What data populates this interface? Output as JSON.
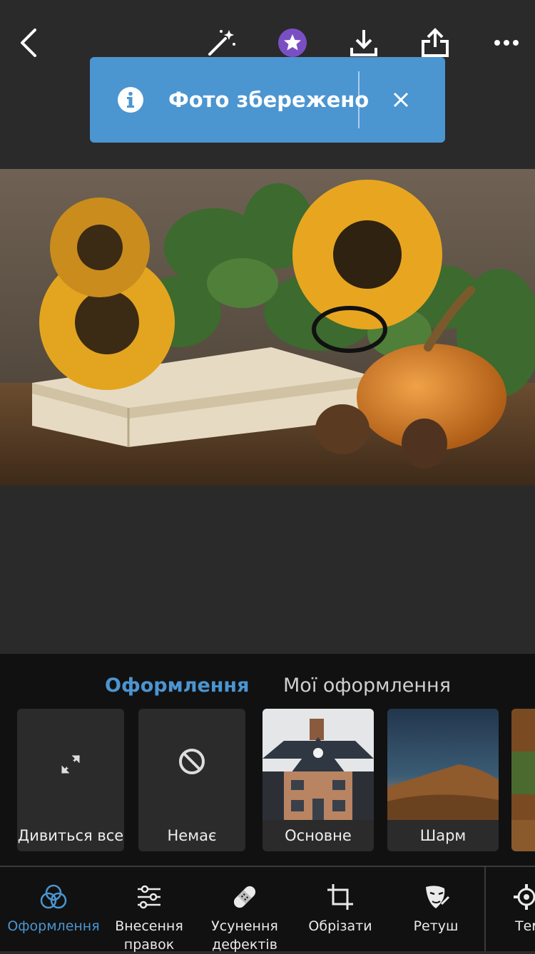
{
  "toolbar": {
    "back_icon": "chevron-left-icon",
    "auto_icon": "magic-wand-icon",
    "premium_icon": "star-badge-icon",
    "download_icon": "download-icon",
    "share_icon": "share-icon",
    "more_icon": "more-icon"
  },
  "toast": {
    "message": "Фото збережено",
    "icon": "info-icon",
    "close_icon": "close-icon",
    "color": "#4b95d1"
  },
  "panel": {
    "tabs": [
      {
        "label": "Оформлення",
        "active": true
      },
      {
        "label": "Мої оформлення",
        "active": false
      }
    ],
    "presets": [
      {
        "label": "Дивиться все",
        "icon": "expand-icon"
      },
      {
        "label": "Немає",
        "icon": "none-icon"
      },
      {
        "label": "Основне",
        "icon": "house-thumbnail"
      },
      {
        "label": "Шарм",
        "icon": "hill-thumbnail"
      }
    ]
  },
  "nav": {
    "items": [
      {
        "label": "Оформлення",
        "icon": "presets-icon",
        "active": true
      },
      {
        "label": "Внесення правок",
        "icon": "sliders-icon",
        "active": false
      },
      {
        "label": "Усунення дефектів",
        "icon": "bandage-icon",
        "active": false
      },
      {
        "label": "Обрізати",
        "icon": "crop-icon",
        "active": false
      },
      {
        "label": "Ретуш",
        "icon": "retouch-icon",
        "active": false
      },
      {
        "label": "Тем",
        "icon": "gear-icon",
        "active": false
      }
    ]
  },
  "colors": {
    "accent": "#4b95d1",
    "background": "#2a2a2a",
    "panel": "#111111"
  }
}
